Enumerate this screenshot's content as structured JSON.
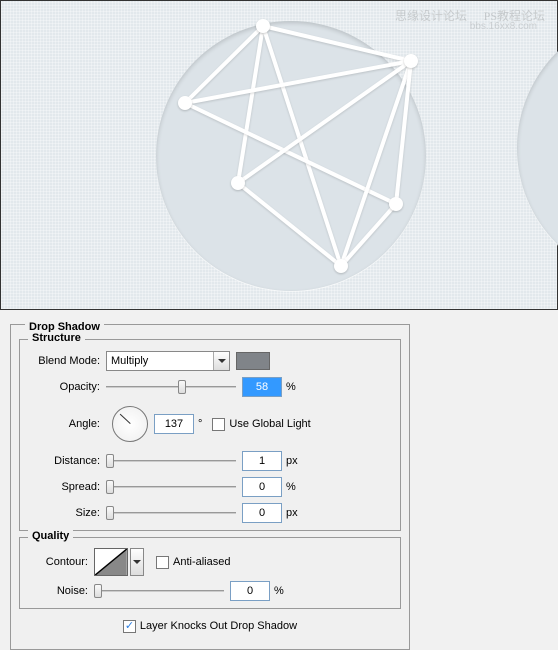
{
  "watermarks": {
    "w1": "思缘设计论坛",
    "w2": "PS教程论坛",
    "w3": "bbs.16xx8.com"
  },
  "panel": {
    "title": "Drop Shadow",
    "structure": {
      "legend": "Structure",
      "blendMode": {
        "label": "Blend Mode:",
        "value": "Multiply",
        "color": "#808489"
      },
      "opacity": {
        "label": "Opacity:",
        "value": "58",
        "unit": "%",
        "sliderPos": 55
      },
      "angle": {
        "label": "Angle:",
        "value": "137",
        "unit": "°",
        "useGlobal": {
          "label": "Use Global Light",
          "checked": false
        }
      },
      "distance": {
        "label": "Distance:",
        "value": "1",
        "unit": "px",
        "sliderPos": 0
      },
      "spread": {
        "label": "Spread:",
        "value": "0",
        "unit": "%",
        "sliderPos": 0
      },
      "size": {
        "label": "Size:",
        "value": "0",
        "unit": "px",
        "sliderPos": 0
      }
    },
    "quality": {
      "legend": "Quality",
      "contour": {
        "label": "Contour:",
        "antiAliased": {
          "label": "Anti-aliased",
          "checked": false
        }
      },
      "noise": {
        "label": "Noise:",
        "value": "0",
        "unit": "%",
        "sliderPos": 0
      }
    },
    "knockout": {
      "label": "Layer Knocks Out Drop Shadow",
      "checked": true
    }
  }
}
